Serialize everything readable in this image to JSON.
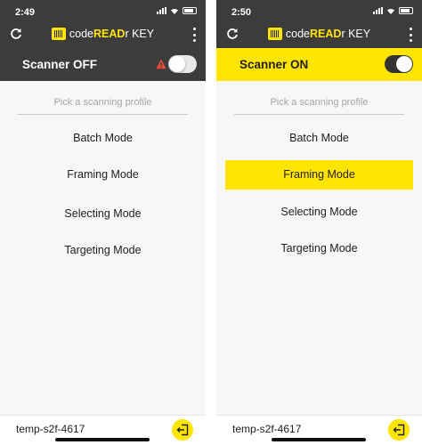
{
  "screens": [
    {
      "status": {
        "time": "2:49"
      },
      "app": {
        "title_prefix": "code",
        "title_bold": "READ",
        "title_suffix": "r KEY"
      },
      "scanner": {
        "label": "Scanner OFF",
        "enabled": false,
        "warning": true
      },
      "profile_picker": {
        "placeholder": "Pick a scanning profile"
      },
      "modes": [
        {
          "label": "Batch Mode",
          "selected": false
        },
        {
          "label": "Framing Mode",
          "selected": false
        },
        {
          "label": "Selecting Mode",
          "selected": false
        },
        {
          "label": "Targeting Mode",
          "selected": false
        }
      ],
      "footer": {
        "user": "temp-s2f-4617"
      }
    },
    {
      "status": {
        "time": "2:50"
      },
      "app": {
        "title_prefix": "code",
        "title_bold": "READ",
        "title_suffix": "r KEY"
      },
      "scanner": {
        "label": "Scanner ON",
        "enabled": true,
        "warning": false
      },
      "profile_picker": {
        "placeholder": "Pick a scanning profile"
      },
      "modes": [
        {
          "label": "Batch Mode",
          "selected": false
        },
        {
          "label": "Framing Mode",
          "selected": true
        },
        {
          "label": "Selecting Mode",
          "selected": false
        },
        {
          "label": "Targeting Mode",
          "selected": false
        }
      ],
      "footer": {
        "user": "temp-s2f-4617"
      }
    }
  ],
  "colors": {
    "accent": "#ffe500",
    "dark_bar": "#3c3c3c",
    "warning": "#e74c3c"
  }
}
